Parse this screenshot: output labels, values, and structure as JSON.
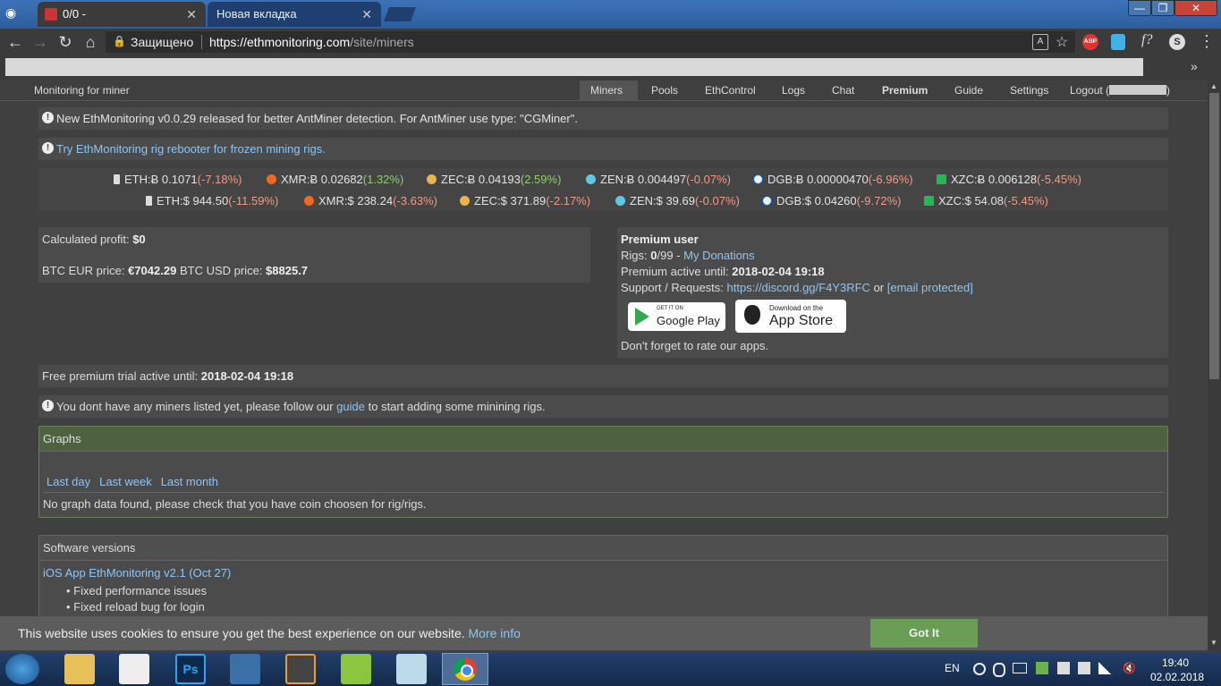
{
  "browser": {
    "tabs": [
      {
        "label": "0/0 -"
      },
      {
        "label": "Новая вкладка"
      }
    ],
    "secure_label": "Защищено",
    "url_host": "https://ethmonitoring.com",
    "url_path": "/site/miners"
  },
  "site": {
    "brand": "Monitoring for miner",
    "nav": [
      "Miners",
      "Pools",
      "EthControl",
      "Logs",
      "Chat",
      "Premium",
      "Guide",
      "Settings",
      "Logout ("
    ],
    "nav_logout_close": ")",
    "notice1": "New EthMonitoring v0.0.29 released for better AntMiner detection. For AntMiner use type: \"CGMiner\".",
    "notice2": "Try EthMonitoring rig rebooter for frozen mining rigs.",
    "ticker_row1": [
      {
        "label": "ETH:Ƀ 0.1071",
        "change": "(-7.18%)",
        "dir": "down"
      },
      {
        "label": "XMR:Ƀ 0.02682",
        "change": "(1.32%)",
        "dir": "up"
      },
      {
        "label": "ZEC:Ƀ 0.04193",
        "change": "(2.59%)",
        "dir": "up"
      },
      {
        "label": "ZEN:Ƀ 0.004497",
        "change": "(-0.07%)",
        "dir": "down"
      },
      {
        "label": "DGB:Ƀ 0.00000470",
        "change": "(-6.96%)",
        "dir": "down"
      },
      {
        "label": "XZC:Ƀ 0.006128",
        "change": "(-5.45%)",
        "dir": "down"
      }
    ],
    "ticker_row2": [
      {
        "label": "ETH:$ 944.50",
        "change": "(-11.59%)",
        "dir": "down"
      },
      {
        "label": "XMR:$ 238.24",
        "change": "(-3.63%)",
        "dir": "down"
      },
      {
        "label": "ZEC:$ 371.89",
        "change": "(-2.17%)",
        "dir": "down"
      },
      {
        "label": "ZEN:$ 39.69",
        "change": "(-0.07%)",
        "dir": "down"
      },
      {
        "label": "DGB:$ 0.04260",
        "change": "(-9.72%)",
        "dir": "down"
      },
      {
        "label": "XZC:$ 54.08",
        "change": "(-5.45%)",
        "dir": "down"
      }
    ],
    "profit_label": "Calculated profit:",
    "profit_value": "$0",
    "btc_eur_label": "BTC EUR price:",
    "btc_eur_value": "€7042.29",
    "btc_usd_label": "BTC USD price:",
    "btc_usd_value": "$8825.7",
    "premium_title": "Premium user",
    "rigs_label": "Rigs:",
    "rigs_value": "0",
    "rigs_total": "/99 -",
    "donations_link": "My Donations",
    "premium_until_label": "Premium active until:",
    "premium_until_value": "2018-02-04 19:18",
    "support_label": "Support / Requests:",
    "support_link": "https://discord.gg/F4Y3RFC",
    "support_or": "or",
    "email_link": "[email protected]",
    "google_play_small": "GET IT ON",
    "google_play_big": "Google Play",
    "app_store_small": "Download on the",
    "app_store_big": "App Store",
    "rate_apps": "Don't forget to rate our apps.",
    "trial_label": "Free premium trial active until:",
    "trial_value": "2018-02-04 19:18",
    "no_miners_pre": "You dont have any miners listed yet, please follow our",
    "no_miners_link": "guide",
    "no_miners_post": "to start adding some minining rigs.",
    "graphs_title": "Graphs",
    "graph_ranges": [
      "Last day",
      "Last week",
      "Last month"
    ],
    "no_graph": "No graph data found, please check that you have coin choosen for rig/rigs.",
    "software_title": "Software versions",
    "software_item": "iOS App EthMonitoring v2.1 (Oct 27)",
    "software_notes": [
      "Fixed performance issues",
      "Fixed reload bug for login"
    ],
    "cookie_text": "This website uses cookies to ensure you get the best experience on our website.",
    "cookie_more": "More info",
    "cookie_button": "Got It"
  },
  "taskbar": {
    "lang": "EN",
    "time": "19:40",
    "date": "02.02.2018"
  },
  "colors": {
    "accent_link": "#8ec5f2",
    "positive": "#8fd06b",
    "negative": "#f19a85",
    "graphs_header": "#4e6240",
    "cookie_button": "#6a9d56"
  }
}
